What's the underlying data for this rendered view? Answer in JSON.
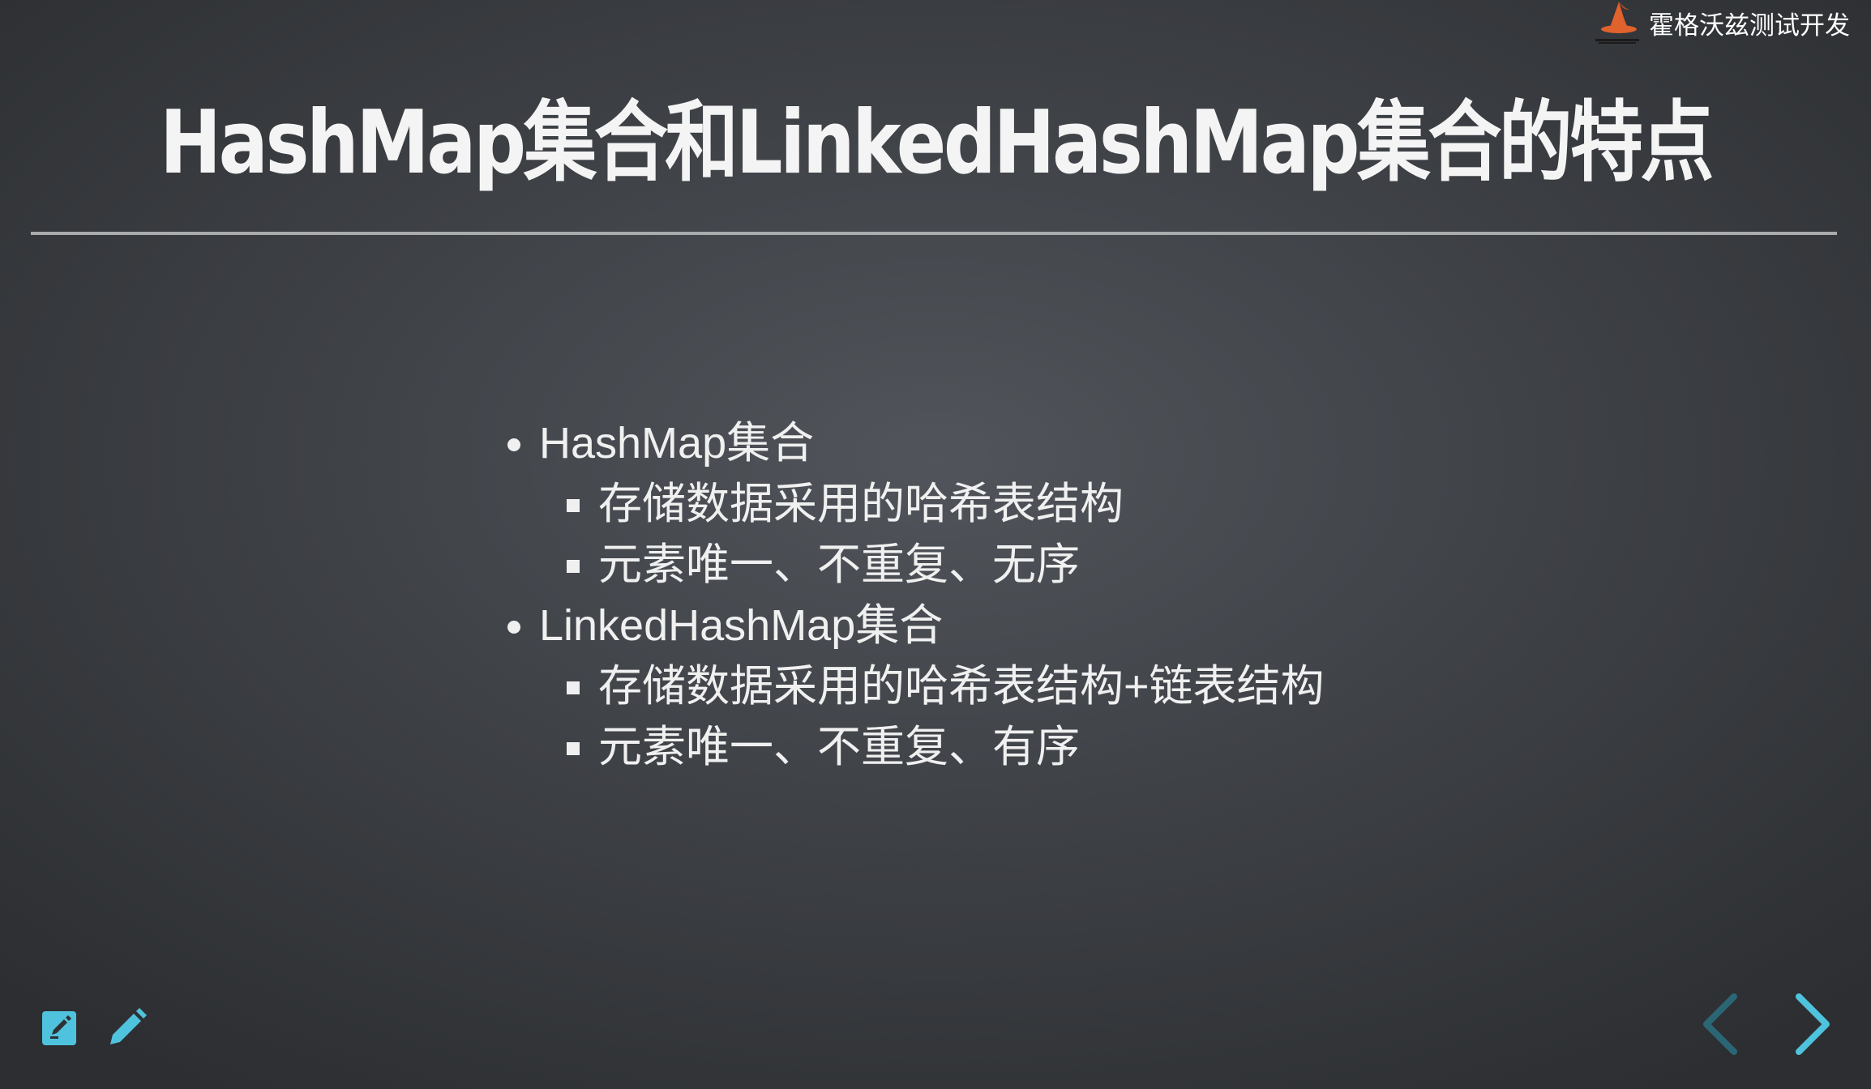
{
  "brand": {
    "name": "霍格沃兹测试开发",
    "logo_icon": "wizard-hat-icon",
    "logo_color": "#e0622c"
  },
  "slide": {
    "title": "HashMap集合和LinkedHashMap集合的特点",
    "bullets": [
      {
        "text": "HashMap集合",
        "subitems": [
          "存储数据采用的哈希表结构",
          "元素唯一、不重复、无序"
        ]
      },
      {
        "text": "LinkedHashMap集合",
        "subitems": [
          "存储数据采用的哈希表结构+链表结构",
          "元素唯一、不重复、有序"
        ]
      }
    ]
  },
  "toolbar": {
    "notes_icon": "edit-note-icon",
    "pen_icon": "pencil-icon",
    "accent_color": "#4fc3dd"
  },
  "navigation": {
    "prev_icon": "chevron-left-icon",
    "next_icon": "chevron-right-icon",
    "prev_enabled": false,
    "next_enabled": true,
    "prev_color": "#2b6675",
    "next_color": "#4fc3dd"
  }
}
